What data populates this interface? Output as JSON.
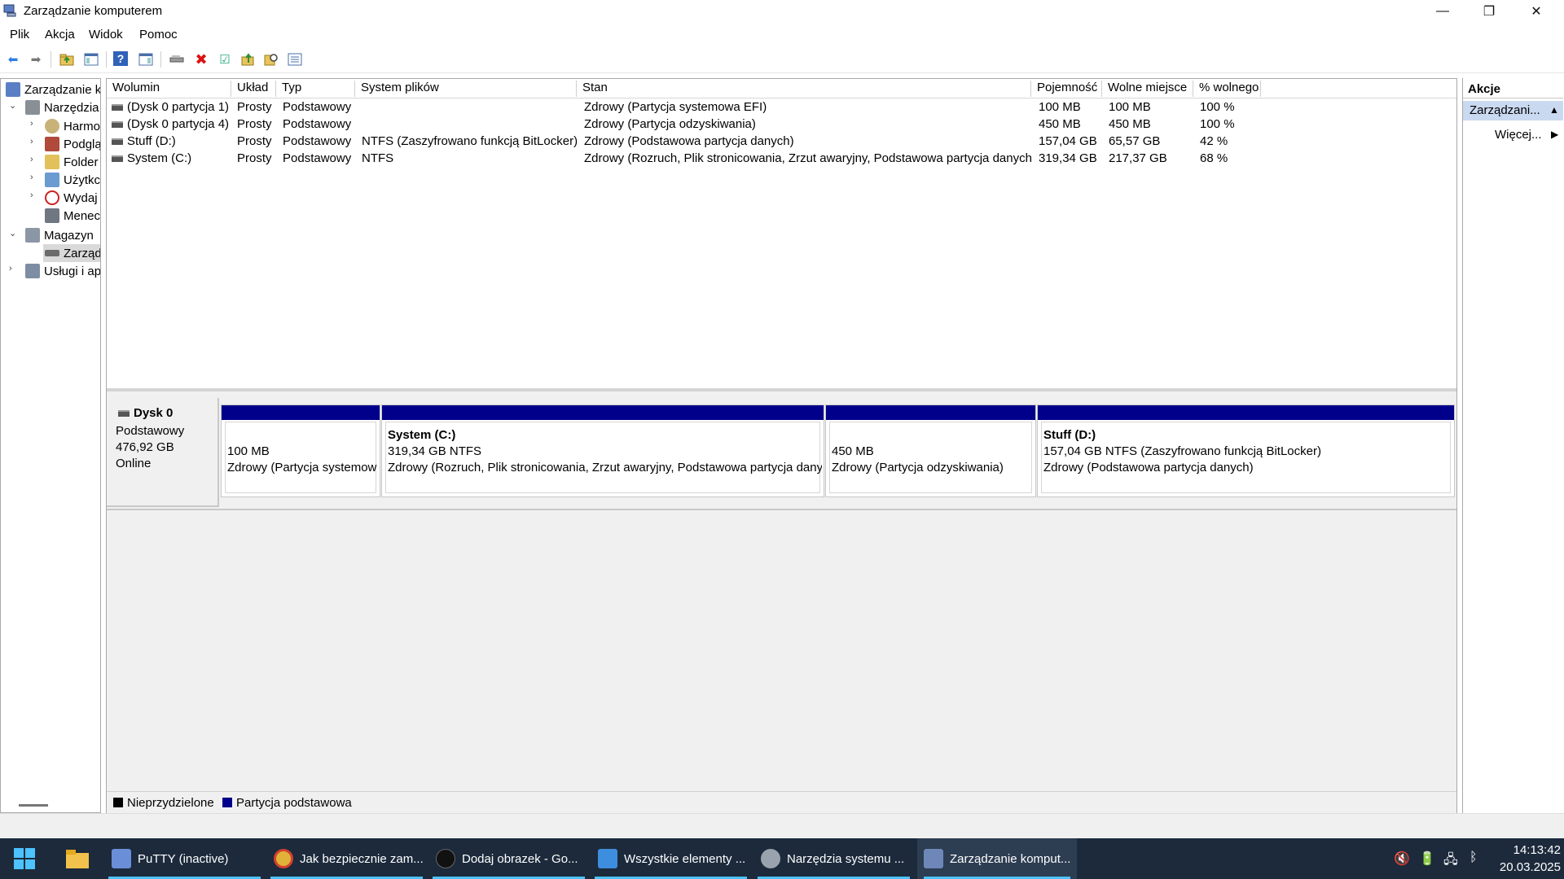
{
  "window": {
    "title": "Zarządzanie komputerem",
    "controls": {
      "minimize": "—",
      "maximize": "❐",
      "close": "✕"
    }
  },
  "menu": [
    "Plik",
    "Akcja",
    "Widok",
    "Pomoc"
  ],
  "toolbar": {
    "icons": [
      "back-icon",
      "forward-icon",
      "up-folder-icon",
      "show-hide-tree-icon",
      "help-icon",
      "show-hide-action-icon",
      "disk-icon",
      "delete-icon",
      "properties-icon",
      "export-icon",
      "search-icon",
      "list-icon"
    ],
    "glyphs": {
      "back": "⬅",
      "forward": "➡",
      "help": "?",
      "delete": "✖",
      "properties": "☑"
    }
  },
  "tree": {
    "items": [
      {
        "label": "Zarządzanie k",
        "expand": "",
        "icon": "computer-management-icon"
      },
      {
        "label": "Narzędzia",
        "expand": "⌄",
        "icon": "tools-icon"
      },
      {
        "label": "Harmo",
        "expand": "›",
        "icon": "clock-icon"
      },
      {
        "label": "Podglą",
        "expand": "›",
        "icon": "event-viewer-icon"
      },
      {
        "label": "Folder",
        "expand": "›",
        "icon": "shared-folder-icon"
      },
      {
        "label": "Użytkc",
        "expand": "›",
        "icon": "users-icon"
      },
      {
        "label": "Wydaj",
        "expand": "›",
        "icon": "performance-icon"
      },
      {
        "label": "Menec",
        "expand": "",
        "icon": "device-manager-icon"
      },
      {
        "label": "Magazyn",
        "expand": "⌄",
        "icon": "storage-icon"
      },
      {
        "label": "Zarząd",
        "expand": "",
        "icon": "disk-management-icon"
      },
      {
        "label": "Usługi i ap",
        "expand": "›",
        "icon": "services-icon"
      }
    ]
  },
  "volumes": {
    "columns": [
      "Wolumin",
      "Układ",
      "Typ",
      "System plików",
      "Stan",
      "Pojemność",
      "Wolne miejsce",
      "% wolnego"
    ],
    "rows": [
      [
        "(Dysk 0 partycja 1)",
        "Prosty",
        "Podstawowy",
        "",
        "Zdrowy (Partycja systemowa EFI)",
        "100 MB",
        "100 MB",
        "100 %"
      ],
      [
        "(Dysk 0 partycja 4)",
        "Prosty",
        "Podstawowy",
        "",
        "Zdrowy (Partycja odzyskiwania)",
        "450 MB",
        "450 MB",
        "100 %"
      ],
      [
        "Stuff (D:)",
        "Prosty",
        "Podstawowy",
        "NTFS (Zaszyfrowano funkcją BitLocker)",
        "Zdrowy (Podstawowa partycja danych)",
        "157,04 GB",
        "65,57 GB",
        "42 %"
      ],
      [
        "System (C:)",
        "Prosty",
        "Podstawowy",
        "NTFS",
        "Zdrowy (Rozruch, Plik stronicowania, Zrzut awaryjny, Podstawowa partycja danych)",
        "319,34 GB",
        "217,37 GB",
        "68 %"
      ]
    ]
  },
  "disk": {
    "name": "Dysk 0",
    "type": "Podstawowy",
    "size": "476,92 GB",
    "status": "Online",
    "partitions": [
      {
        "title": "",
        "line1": "100 MB",
        "line2": "Zdrowy (Partycja systemow"
      },
      {
        "title": "System  (C:)",
        "line1": "319,34 GB NTFS",
        "line2": "Zdrowy (Rozruch, Plik stronicowania, Zrzut awaryjny, Podstawowa partycja dany"
      },
      {
        "title": "",
        "line1": "450 MB",
        "line2": "Zdrowy (Partycja odzyskiwania)"
      },
      {
        "title": "Stuff  (D:)",
        "line1": "157,04 GB NTFS (Zaszyfrowano funkcją BitLocker)",
        "line2": "Zdrowy (Podstawowa partycja danych)"
      }
    ]
  },
  "legend": [
    {
      "label": "Nieprzydzielone",
      "color": "#000000"
    },
    {
      "label": "Partycja podstawowa",
      "color": "#00008b"
    }
  ],
  "actions": {
    "header": "Akcje",
    "section": "Zarządzani...",
    "more": "Więcej..."
  },
  "taskbar": {
    "tasks": [
      {
        "label": "PuTTY (inactive)",
        "icon": "putty-icon",
        "color": "#6a8fd8"
      },
      {
        "label": "Jak bezpiecznie zam...",
        "icon": "chrome-icon",
        "color": "#e0b23a"
      },
      {
        "label": "Dodaj obrazek - Go...",
        "icon": "chatgpt-icon",
        "color": "#111111"
      },
      {
        "label": "Wszystkie elementy ...",
        "icon": "control-panel-icon",
        "color": "#3d8ede"
      },
      {
        "label": "Narzędzia systemu ...",
        "icon": "admin-tools-icon",
        "color": "#9aa3ad"
      },
      {
        "label": "Zarządzanie komput...",
        "icon": "computer-management-icon",
        "color": "#6d87b8"
      }
    ],
    "clock_time": "14:13:42",
    "clock_date": "20.03.2025",
    "tray_icons": [
      "volume-muted-icon",
      "battery-icon",
      "network-icon",
      "bluetooth-icon"
    ],
    "tray_glyphs": [
      "🔇",
      "🔋",
      "🖧",
      "ᛒ"
    ]
  }
}
